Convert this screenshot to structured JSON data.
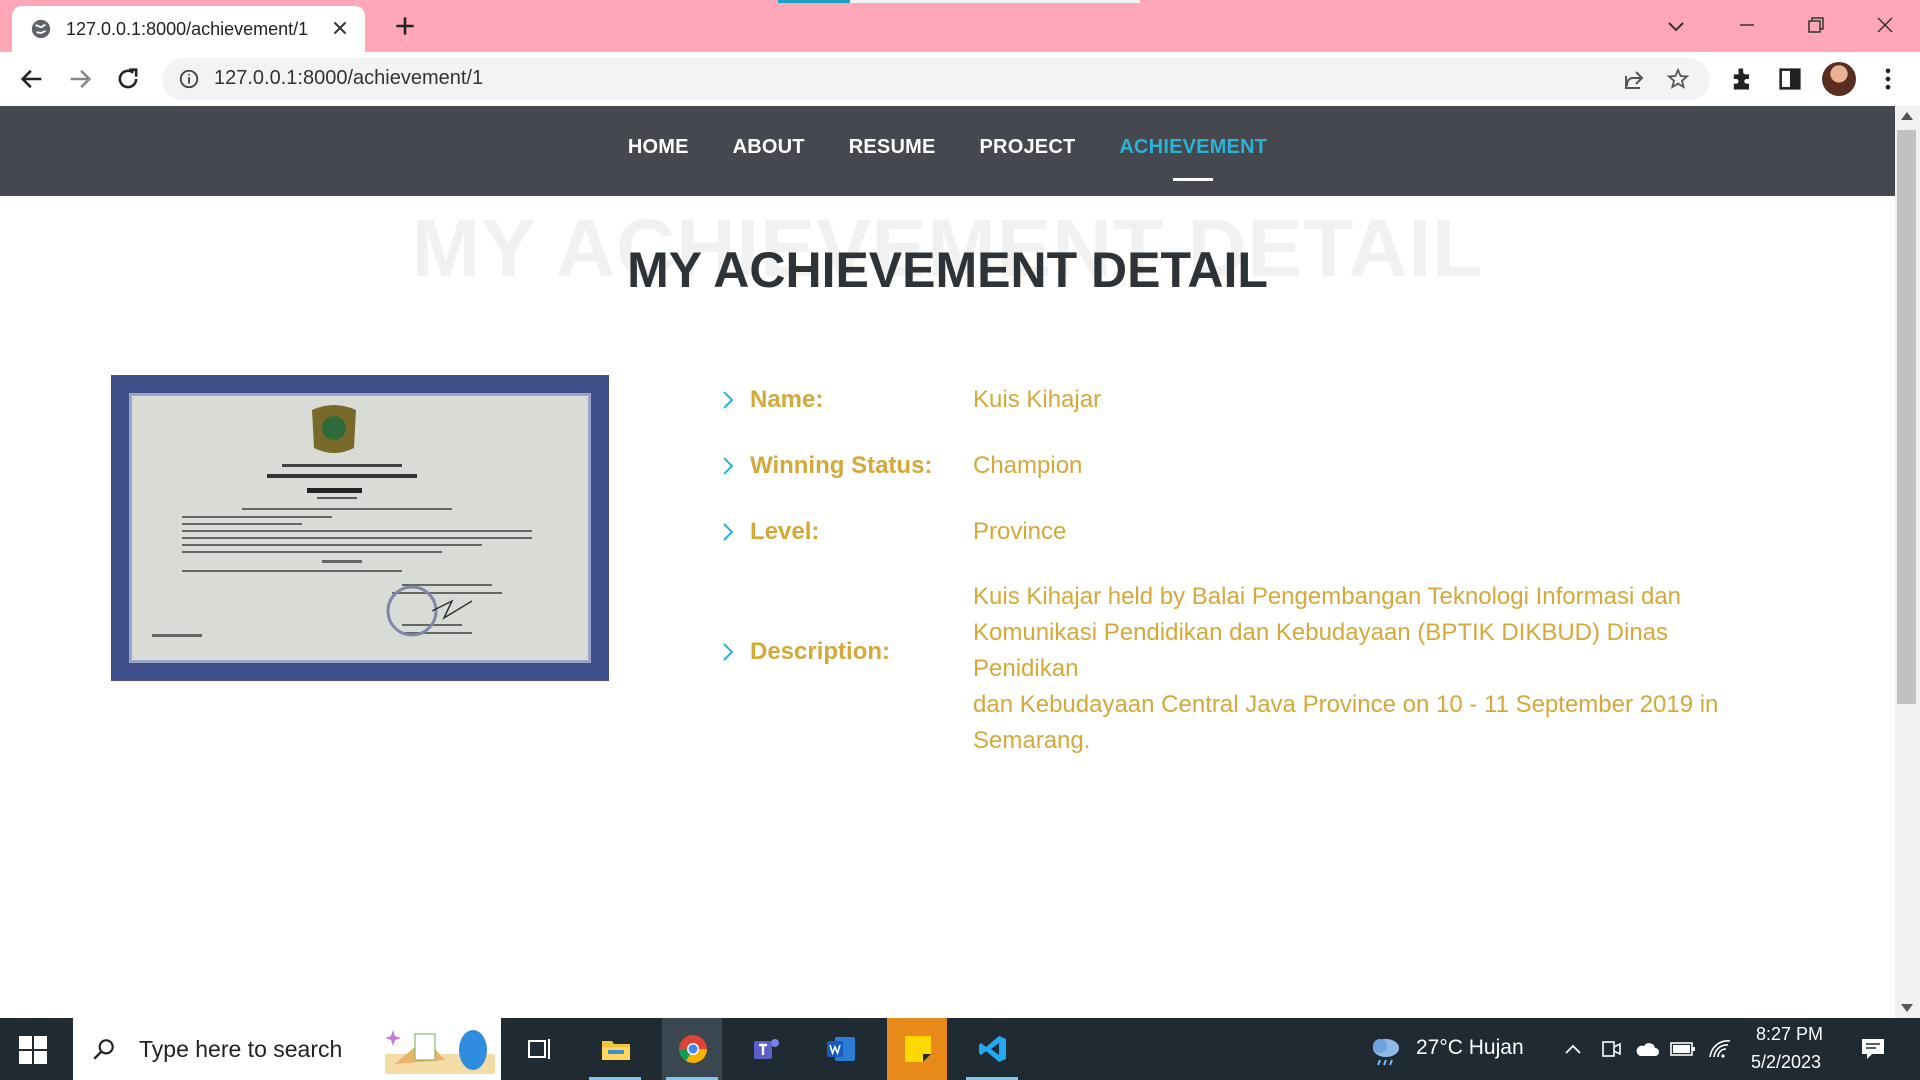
{
  "browser": {
    "tab_title": "127.0.0.1:8000/achievement/1",
    "url": "127.0.0.1:8000/achievement/1"
  },
  "site": {
    "nav": [
      "HOME",
      "ABOUT",
      "RESUME",
      "PROJECT",
      "ACHIEVEMENT"
    ],
    "active_nav": "ACHIEVEMENT",
    "title_bg": "MY ACHIEVEMENT DETAIL",
    "title": "MY ACHIEVEMENT DETAIL",
    "details": [
      {
        "label": "Name:",
        "value": "Kuis Kihajar"
      },
      {
        "label": "Winning Status:",
        "value": "Champion"
      },
      {
        "label": "Level:",
        "value": "Province"
      },
      {
        "label": "Description:",
        "value": ""
      }
    ],
    "description_lines": [
      "Kuis Kihajar held by Balai Pengembangan Teknologi Informasi dan",
      "Komunikasi Pendidikan dan Kebudayaan (BPTIK DIKBUD) Dinas Penidikan",
      "dan Kebudayaan Central Java Province on 10 - 11 September 2019 in",
      "Semarang."
    ]
  },
  "taskbar": {
    "search_placeholder": "Type here to search",
    "weather": "27°C  Hujan",
    "time": "8:27 PM",
    "date": "5/2/2023"
  },
  "colors": {
    "chrome": "#ffa6b8",
    "nav_bg": "#45484e",
    "accent": "#2ab3d6",
    "gold": "#d5a83a"
  }
}
